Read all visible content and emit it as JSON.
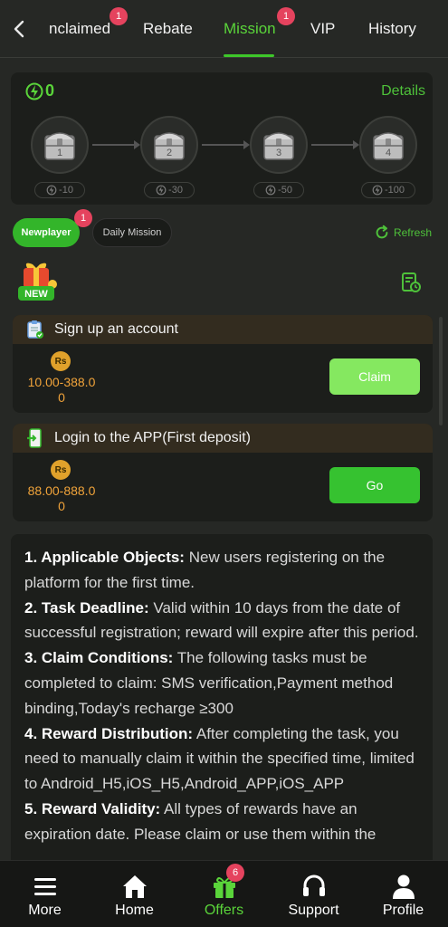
{
  "tabs": [
    {
      "label": "nclaimed",
      "badge": "1"
    },
    {
      "label": "Rebate"
    },
    {
      "label": "Mission",
      "badge": "1"
    },
    {
      "label": "VIP"
    },
    {
      "label": "History"
    }
  ],
  "energy": {
    "count": "0",
    "details_label": "Details"
  },
  "chests": [
    {
      "num": "1",
      "cost": "-10"
    },
    {
      "num": "2",
      "cost": "-30"
    },
    {
      "num": "3",
      "cost": "-50"
    },
    {
      "num": "4",
      "cost": "-100"
    }
  ],
  "subtabs": {
    "newplayer": "Newplayer",
    "newplayer_badge": "1",
    "daily": "Daily Mission",
    "refresh": "Refresh"
  },
  "new_badge": "NEW",
  "tasks": [
    {
      "title": "Sign up an account",
      "currency": "Rs",
      "reward": "10.00-388.0\n0",
      "button": "Claim"
    },
    {
      "title": "Login to the APP(First deposit)",
      "currency": "Rs",
      "reward": "88.00-888.0\n0",
      "button": "Go"
    }
  ],
  "rules": [
    {
      "head": "1. Applicable Objects:",
      "text": " New users registering on the platform for the first time."
    },
    {
      "head": "2. Task Deadline:",
      "text": " Valid within 10 days from the date of successful registration; reward will expire after this period."
    },
    {
      "head": "3. Claim Conditions:",
      "text": " The following tasks must be completed to claim: SMS verification,Payment method binding,Today's recharge ≥300"
    },
    {
      "head": "4. Reward Distribution:",
      "text": " After completing the task, you need to manually claim it within the specified time, limited to Android_H5,iOS_H5,Android_APP,iOS_APP"
    },
    {
      "head": "5. Reward Validity:",
      "text": " All types of rewards have an expiration date. Please claim or use them within the"
    }
  ],
  "nav": [
    {
      "label": "More",
      "icon": "menu-icon"
    },
    {
      "label": "Home",
      "icon": "home-icon"
    },
    {
      "label": "Offers",
      "icon": "gift-icon",
      "badge": "6"
    },
    {
      "label": "Support",
      "icon": "headset-icon"
    },
    {
      "label": "Profile",
      "icon": "user-icon"
    }
  ],
  "colors": {
    "accent": "#5ad43a",
    "badge": "#e5435e",
    "reward": "#f0a33a",
    "background": "#262825"
  }
}
